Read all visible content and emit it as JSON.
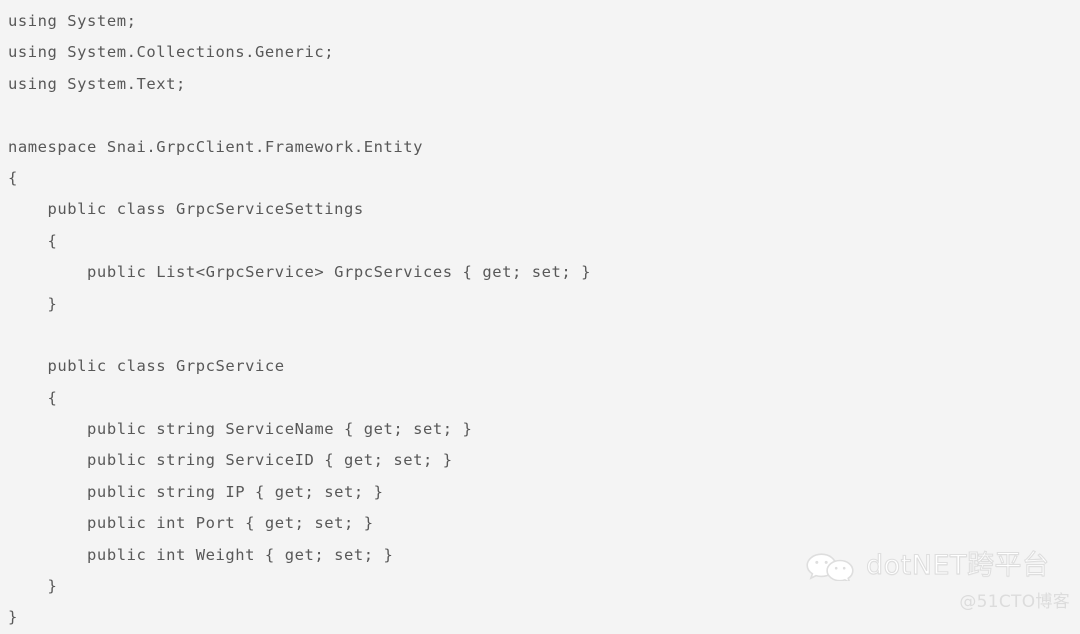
{
  "page": {
    "background_color": "#f4f4f4",
    "text_color": "#585858",
    "language": "csharp"
  },
  "code": {
    "lines": [
      "using System;",
      "using System.Collections.Generic;",
      "using System.Text;",
      "",
      "namespace Snai.GrpcClient.Framework.Entity",
      "{",
      "    public class GrpcServiceSettings",
      "    {",
      "        public List<GrpcService> GrpcServices { get; set; }",
      "    }",
      "",
      "    public class GrpcService",
      "    {",
      "        public string ServiceName { get; set; }",
      "        public string ServiceID { get; set; }",
      "        public string IP { get; set; }",
      "        public int Port { get; set; }",
      "        public int Weight { get; set; }",
      "    }",
      "}"
    ]
  },
  "watermark": {
    "icon": "wechat-icon",
    "title": "dotNET跨平台",
    "subtitle": "@51CTO博客",
    "title_color": "#dedede",
    "subtitle_color": "#dcdcdc"
  }
}
